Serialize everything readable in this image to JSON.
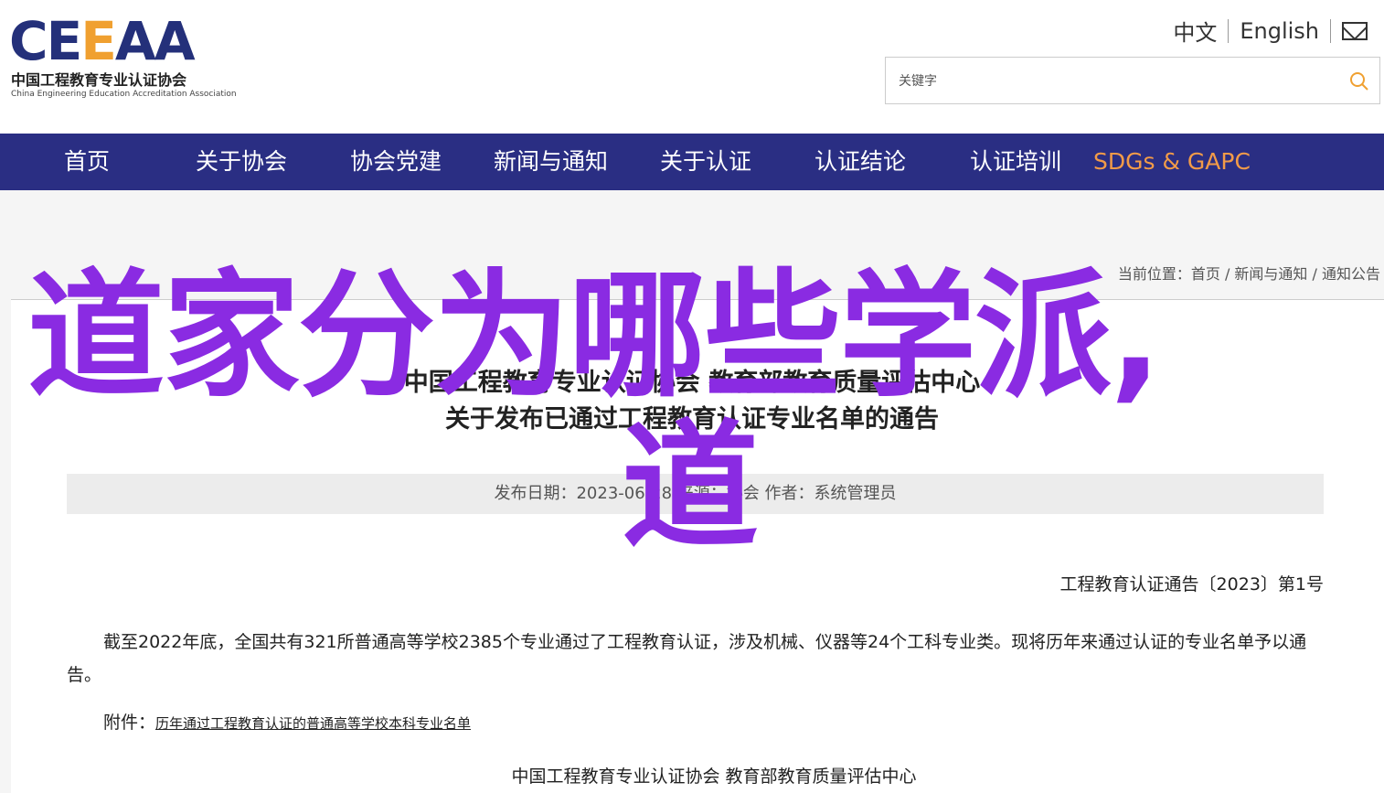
{
  "logo": {
    "mark_left": "CE",
    "mark_accent": "E",
    "mark_right": "AA",
    "name_cn": "中国工程教育专业认证协会",
    "name_en": "China Engineering Education Accreditation Association"
  },
  "lang": {
    "cn": "中文",
    "en": "English"
  },
  "search": {
    "placeholder": "关键字"
  },
  "nav": {
    "items": [
      {
        "label": "首页"
      },
      {
        "label": "关于协会"
      },
      {
        "label": "协会党建"
      },
      {
        "label": "新闻与通知"
      },
      {
        "label": "关于认证"
      },
      {
        "label": "认证结论"
      },
      {
        "label": "认证培训"
      },
      {
        "label": "SDGs & GAPC"
      }
    ],
    "highlight_color": "#f29b48"
  },
  "breadcrumb": "当前位置：首页 / 新闻与通知 / 通知公告",
  "article": {
    "title_line1": "中国工程教育专业认证协会 教育部教育质量评估中心",
    "title_line2": "关于发布已通过工程教育认证专业名单的通告",
    "meta": "发布日期：2023-06-28    来源：协会    作者：系统管理员",
    "doc_no": "工程教育认证通告〔2023〕第1号",
    "paragraph": "截至2022年底，全国共有321所普通高等学校2385个专业通过了工程教育认证，涉及机械、仪器等24个工科专业类。现将历年来通过认证的专业名单予以通告。",
    "attachment_label": "附件：",
    "attachment_link": "历年通过工程教育认证的普通高等学校本科专业名单",
    "signature": "中国工程教育专业认证协会     教育部教育质量评估中心"
  },
  "overlay": {
    "line1": "道家分为哪些学派,",
    "line2": "道",
    "color": "#8a2be2"
  }
}
